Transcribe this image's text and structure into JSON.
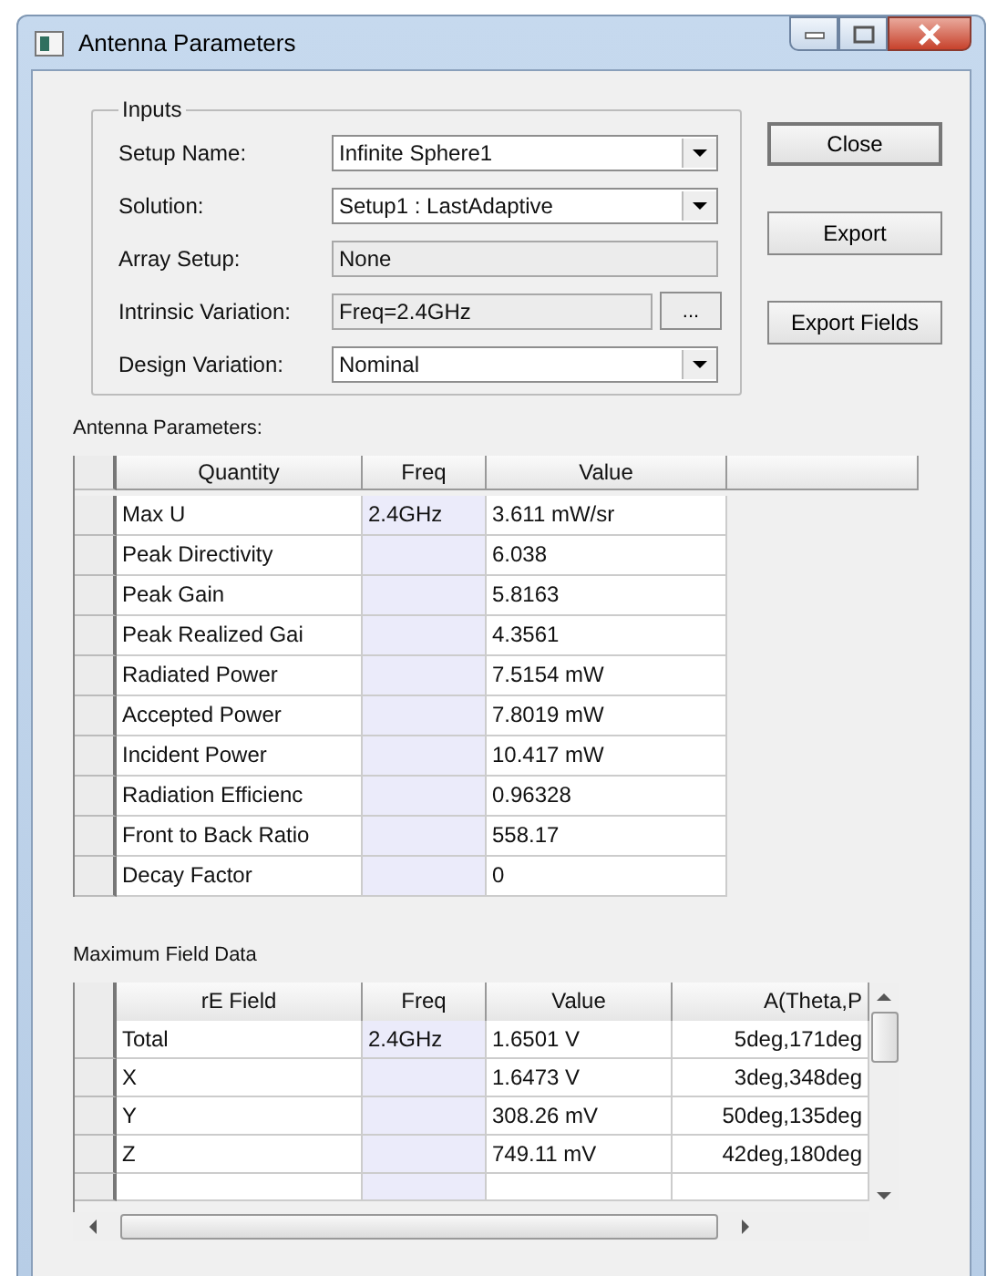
{
  "window": {
    "title": "Antenna Parameters"
  },
  "inputs": {
    "title": "Inputs",
    "fields": [
      {
        "label": "Setup Name:",
        "value": "Infinite Sphere1",
        "kind": "dropdown"
      },
      {
        "label": "Solution:",
        "value": "Setup1 : LastAdaptive",
        "kind": "dropdown"
      },
      {
        "label": "Array Setup:",
        "value": "None",
        "kind": "readonly"
      },
      {
        "label": "Intrinsic Variation:",
        "value": "Freq=2.4GHz",
        "kind": "browse",
        "button": "..."
      },
      {
        "label": "Design Variation:",
        "value": "Nominal",
        "kind": "dropdown"
      }
    ]
  },
  "buttons": [
    "Close",
    "Export",
    "Export Fields"
  ],
  "antenna_table": {
    "title": "Antenna Parameters:",
    "columns": [
      "Quantity",
      "Freq",
      "Value"
    ],
    "rows": [
      {
        "quantity": "Max U",
        "freq": "2.4GHz",
        "value": "3.611 mW/sr"
      },
      {
        "quantity": "Peak Directivity",
        "value": "6.038"
      },
      {
        "quantity": "Peak Gain",
        "value": "5.8163"
      },
      {
        "quantity": "Peak Realized Gai",
        "value": "4.3561"
      },
      {
        "quantity": "Radiated Power",
        "value": "7.5154 mW"
      },
      {
        "quantity": "Accepted Power",
        "value": "7.8019 mW"
      },
      {
        "quantity": "Incident Power",
        "value": "10.417 mW"
      },
      {
        "quantity": "Radiation Efficienc",
        "value": "0.96328"
      },
      {
        "quantity": "Front to Back Ratio",
        "value": "558.17"
      },
      {
        "quantity": "Decay Factor",
        "value": "0"
      }
    ]
  },
  "field_table": {
    "title": "Maximum Field Data",
    "columns": [
      "rE Field",
      "Freq",
      "Value",
      "A(Theta,P"
    ],
    "rows": [
      {
        "field": "Total",
        "freq": "2.4GHz",
        "value": "1.6501 V",
        "angle": "5deg,171deg"
      },
      {
        "field": "X",
        "value": "1.6473 V",
        "angle": "3deg,348deg"
      },
      {
        "field": "Y",
        "value": "308.26 mV",
        "angle": "50deg,135deg"
      },
      {
        "field": "Z",
        "value": "749.11 mV",
        "angle": "42deg,180deg"
      }
    ]
  }
}
